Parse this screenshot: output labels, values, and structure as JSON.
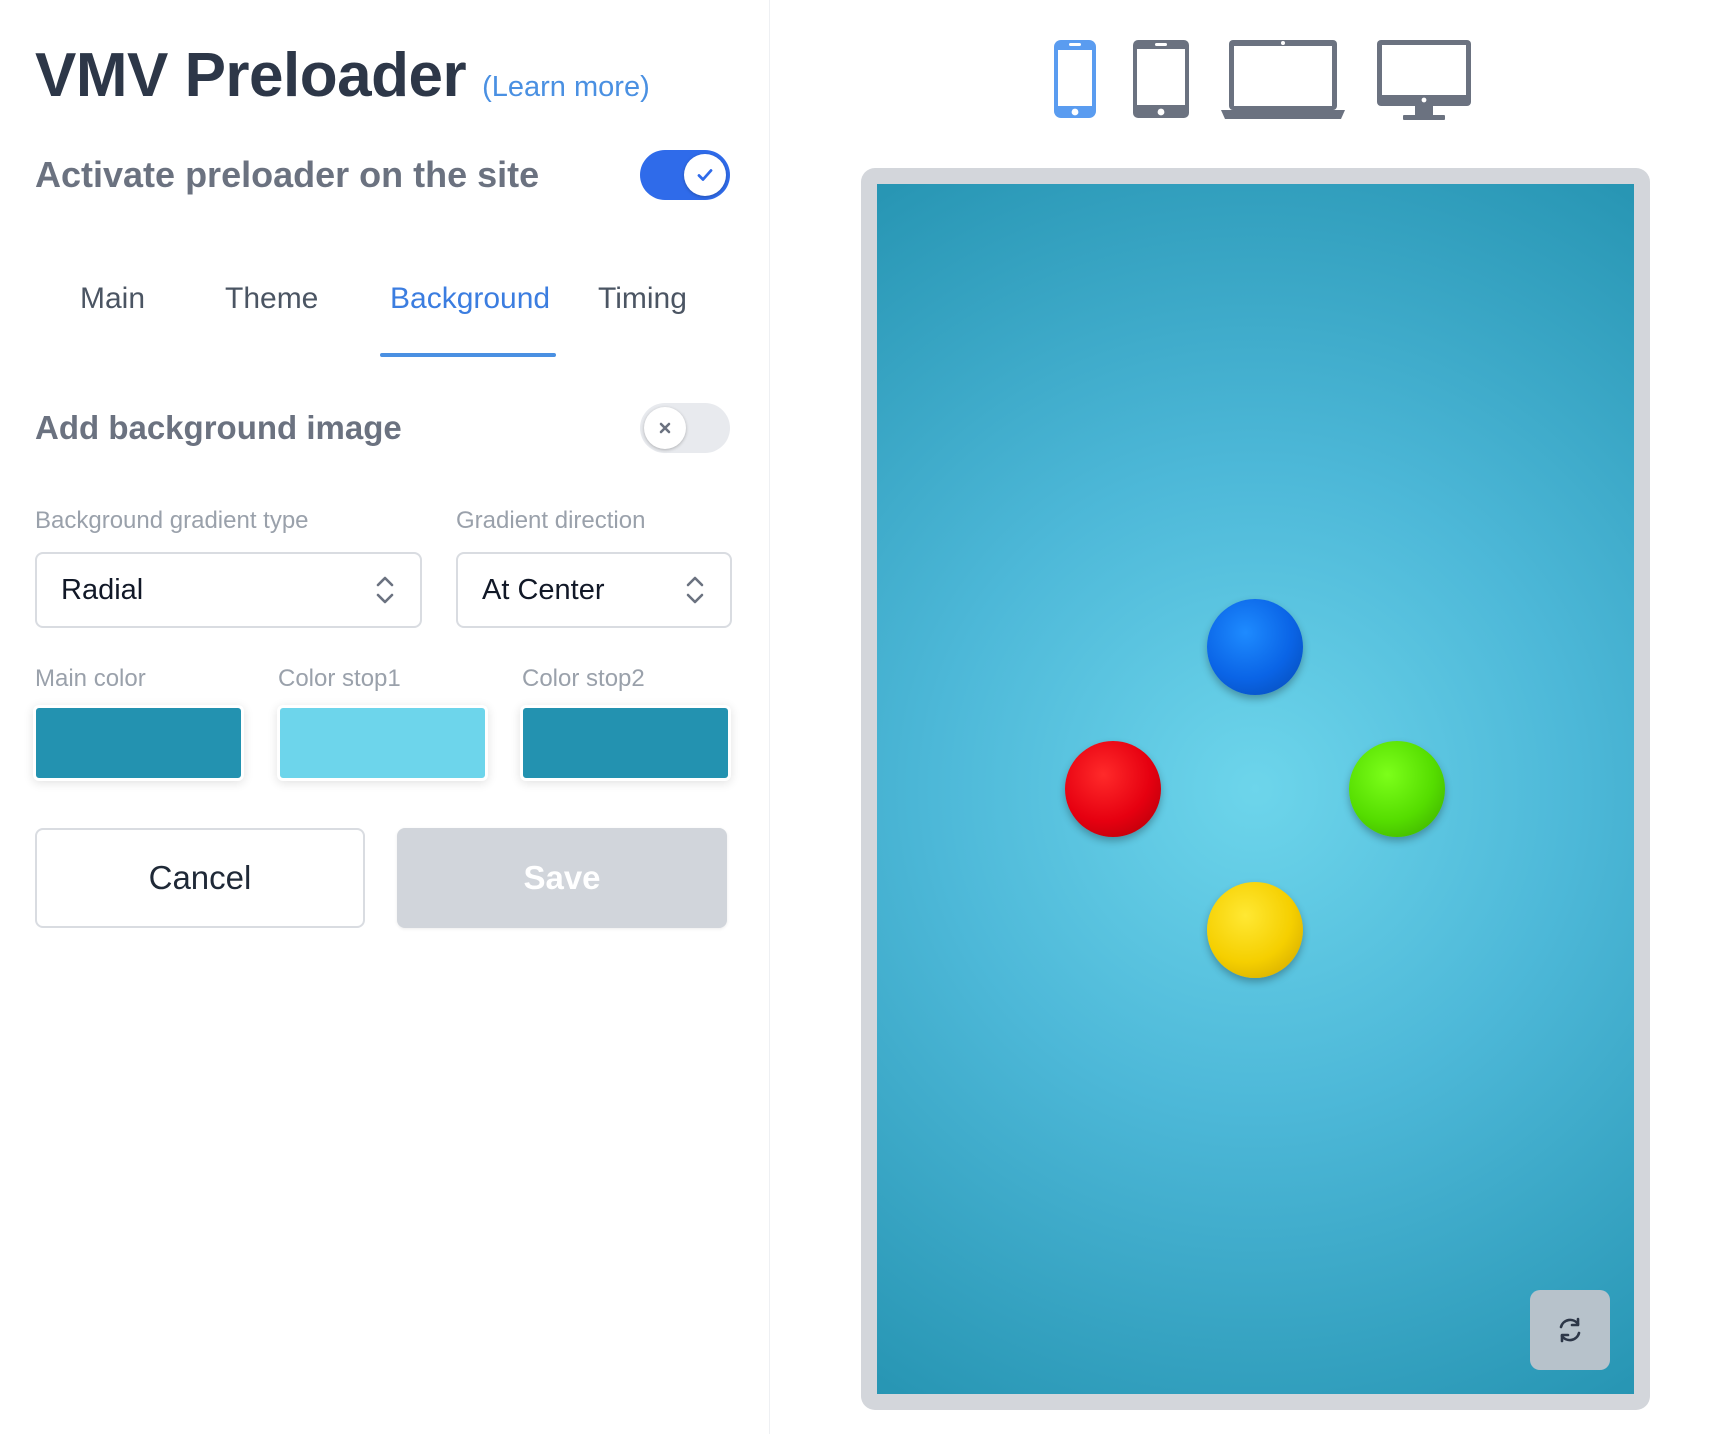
{
  "header": {
    "title": "VMV Preloader",
    "learn_more": "(Learn more)"
  },
  "activate": {
    "label": "Activate preloader on the site",
    "enabled": true
  },
  "tabs": [
    {
      "label": "Main",
      "active": false
    },
    {
      "label": "Theme",
      "active": false
    },
    {
      "label": "Background",
      "active": true
    },
    {
      "label": "Timing",
      "active": false
    }
  ],
  "background_image": {
    "label": "Add background image",
    "enabled": false
  },
  "gradient_type": {
    "label": "Background gradient type",
    "value": "Radial"
  },
  "gradient_direction": {
    "label": "Gradient direction",
    "value": "At Center"
  },
  "colors": {
    "main_label": "Main color",
    "main_value": "#2392b0",
    "stop1_label": "Color stop1",
    "stop1_value": "#6dd5eb",
    "stop2_label": "Color stop2",
    "stop2_value": "#2392b0"
  },
  "buttons": {
    "cancel": "Cancel",
    "save": "Save"
  },
  "devices": [
    {
      "name": "phone-icon",
      "active": true
    },
    {
      "name": "tablet-icon",
      "active": false
    },
    {
      "name": "laptop-icon",
      "active": false
    },
    {
      "name": "desktop-icon",
      "active": false
    }
  ],
  "preview": {
    "balls": [
      "blue",
      "red",
      "green",
      "yellow"
    ],
    "refresh_icon": "refresh-icon"
  },
  "accent_color": "#2f6bea"
}
